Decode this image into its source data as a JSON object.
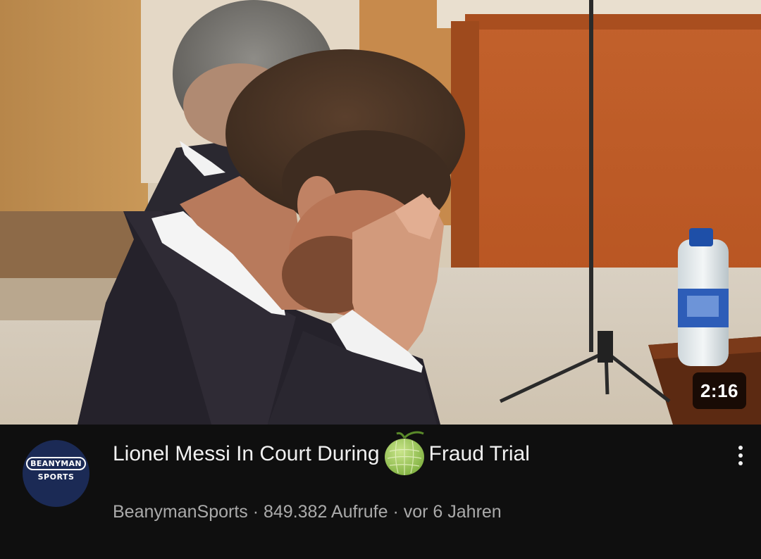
{
  "video": {
    "duration": "2:16",
    "title_part1": "Lionel Messi In Court During",
    "title_emoji": "melon-emoji",
    "title_part2": "Fraud Trial",
    "meta": "BeanymanSports · 849.382 Aufrufe · vor 6 Jahren"
  },
  "channel": {
    "avatar_top": "BEANYMAN",
    "avatar_bottom": "SPORTS",
    "avatar_color": "#1b2a55"
  },
  "icons": {
    "menu": "more-vert-icon"
  },
  "colors": {
    "background": "#0f0f0f",
    "title": "#f1f1f1",
    "meta": "#aaaaaa"
  }
}
